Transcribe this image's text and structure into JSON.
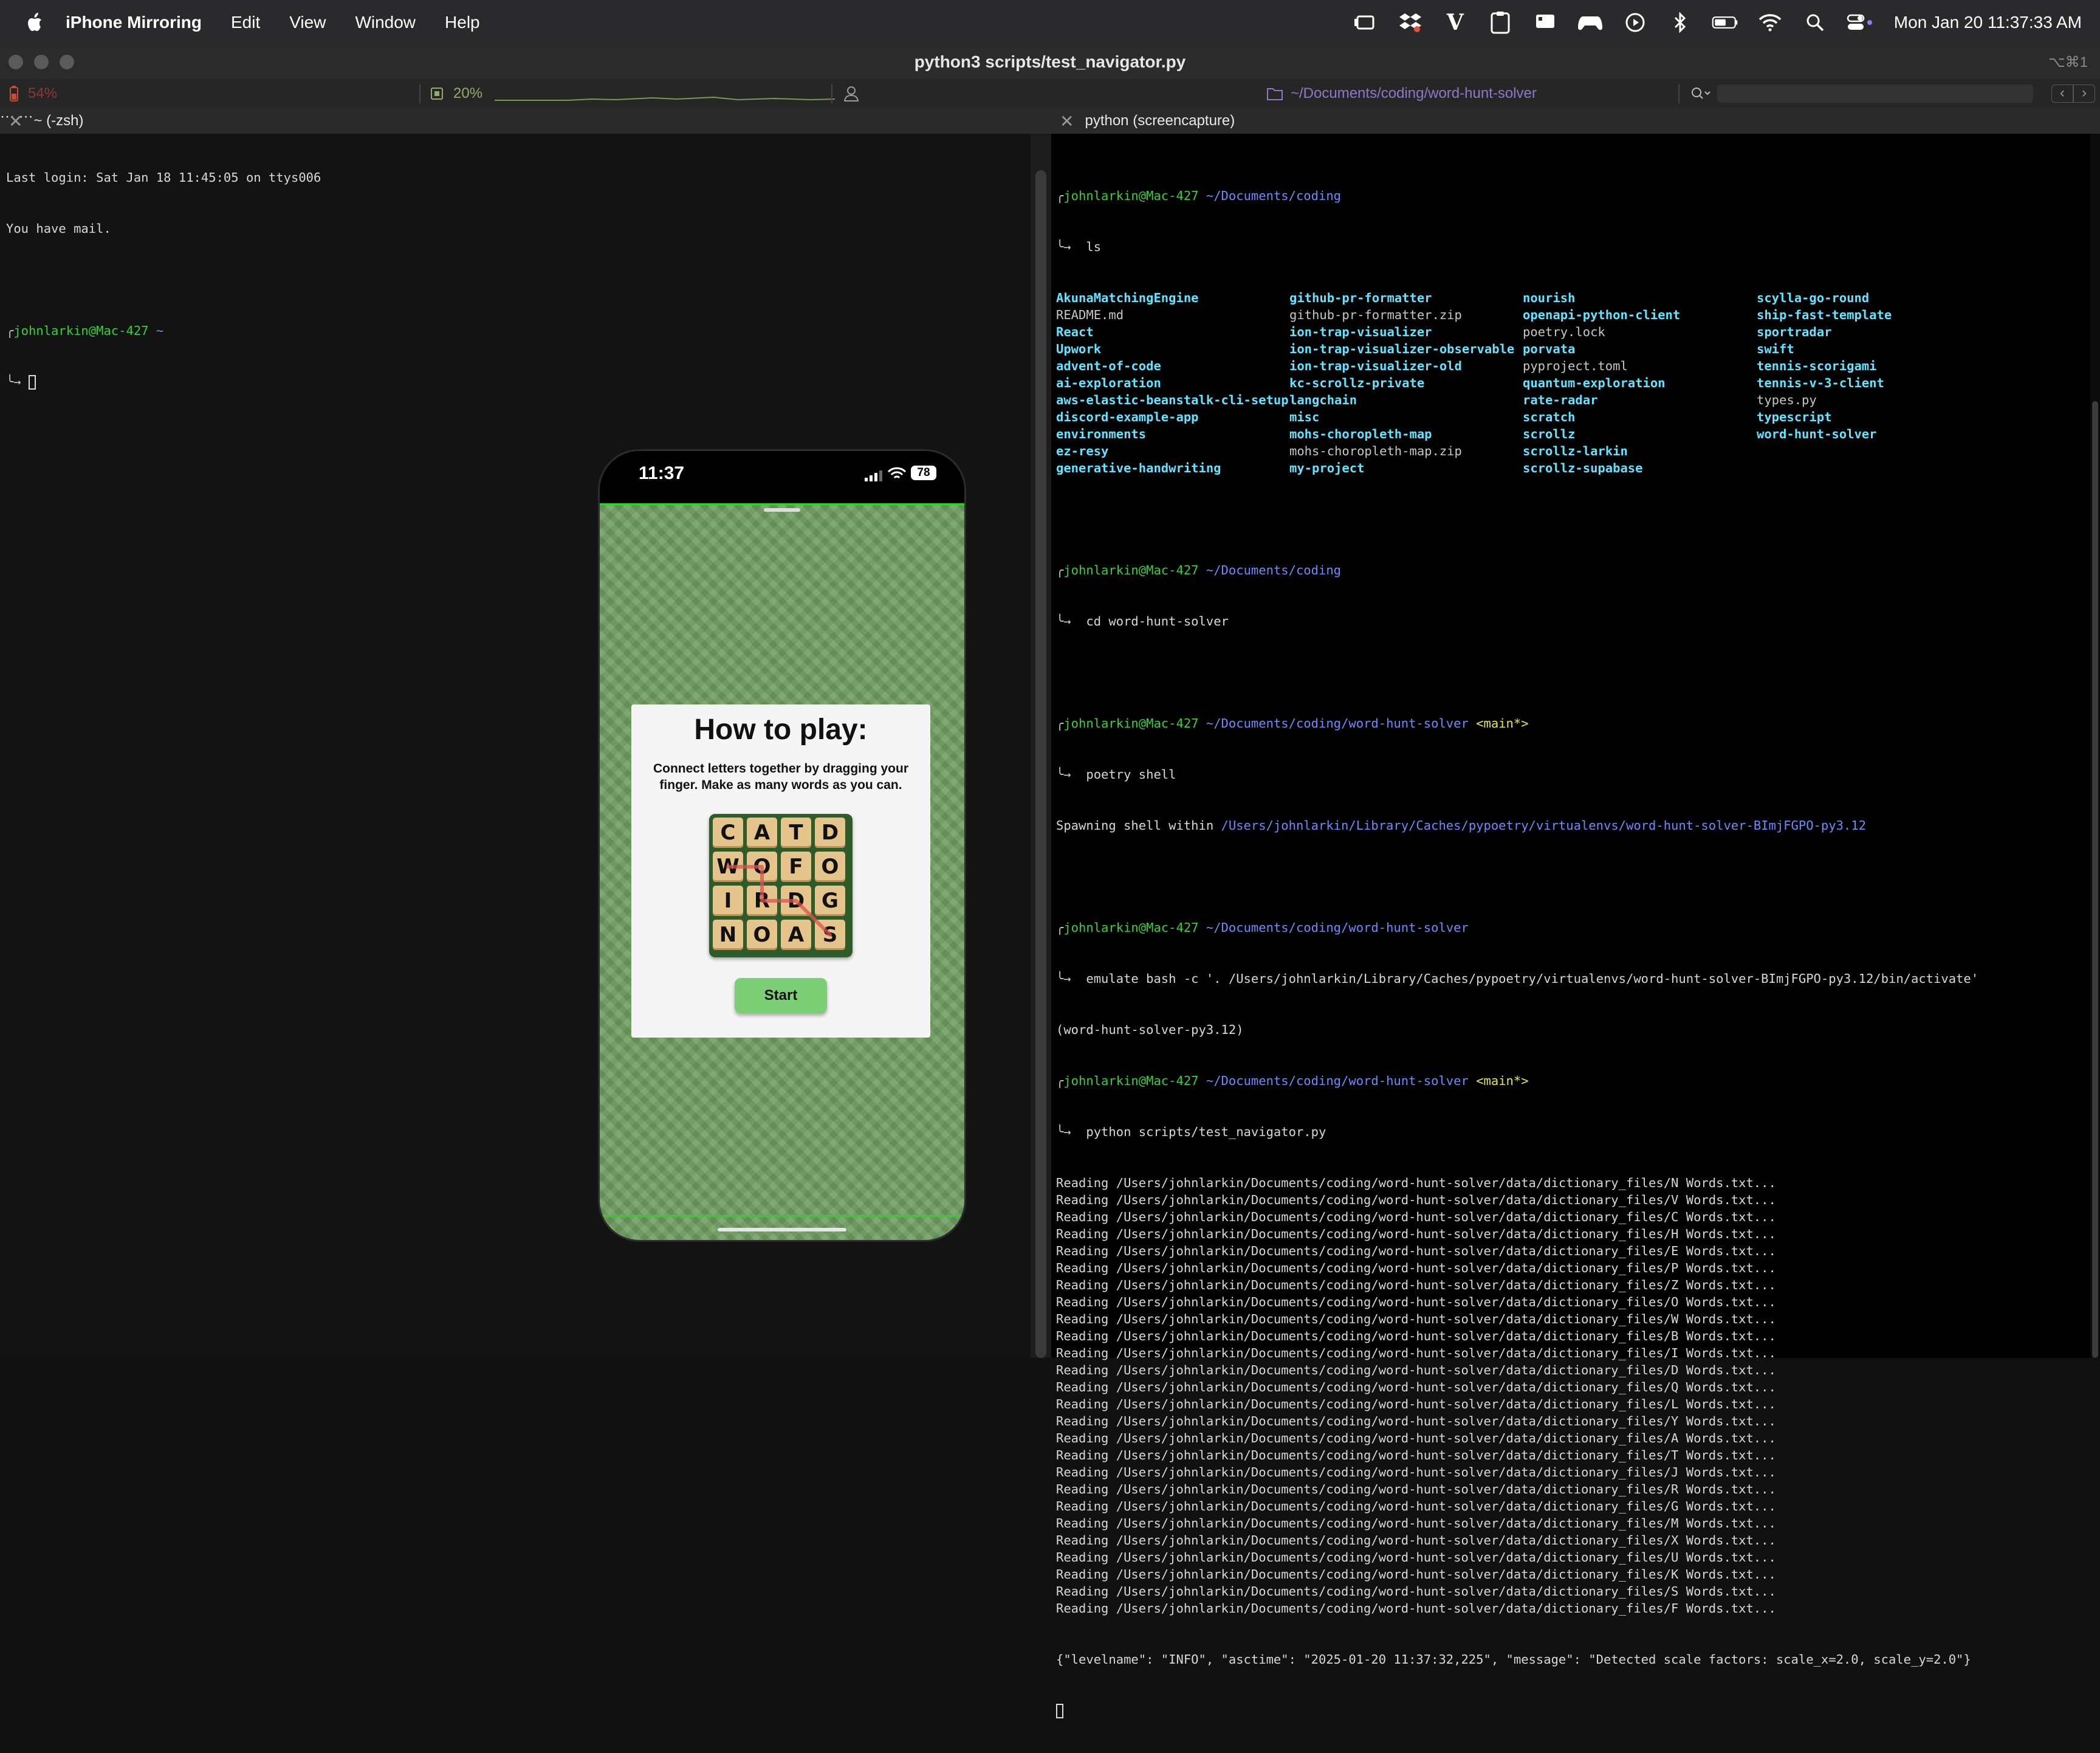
{
  "menubar": {
    "app_name": "iPhone Mirroring",
    "items": [
      "Edit",
      "View",
      "Window",
      "Help"
    ],
    "clock": "Mon Jan 20  11:37:33 AM",
    "icons": [
      "stage-manager-icon",
      "dropbox-icon",
      "vim-icon",
      "clipboard-icon",
      "display-icon",
      "game-controller-icon",
      "play-icon",
      "bluetooth-icon",
      "battery-icon",
      "wifi-icon",
      "spotlight-search-icon",
      "control-center-icon"
    ]
  },
  "window": {
    "title": "python3 scripts/test_navigator.py",
    "shortcut": "⌥⌘1"
  },
  "status_bar": {
    "battery": "54%",
    "cpu": "20%",
    "path": "~/Documents/coding/word-hunt-solver"
  },
  "tabs": {
    "left": "~ (-zsh)",
    "right": "python (screencapture)"
  },
  "left_terminal": {
    "lines": [
      "Last login: Sat Jan 18 11:45:05 on ttys006",
      "You have mail."
    ],
    "prompt_user": "johnlarkin@Mac-427",
    "prompt_path": "~"
  },
  "right_terminal": {
    "prompt_user": "johnlarkin@Mac-427",
    "path_coding": "~/Documents/coding",
    "path_solver": "~/Documents/coding/word-hunt-solver",
    "branch": "<main*>",
    "cmd_ls": "ls",
    "ls_columns": [
      [
        "AkunaMatchingEngine",
        "README.md",
        "React",
        "Upwork",
        "advent-of-code",
        "ai-exploration",
        "aws-elastic-beanstalk-cli-setup",
        "discord-example-app",
        "environments",
        "ez-resy",
        "generative-handwriting"
      ],
      [
        "github-pr-formatter",
        "github-pr-formatter.zip",
        "ion-trap-visualizer",
        "ion-trap-visualizer-observable",
        "ion-trap-visualizer-old",
        "kc-scrollz-private",
        "langchain",
        "misc",
        "mohs-choropleth-map",
        "mohs-choropleth-map.zip",
        "my-project"
      ],
      [
        "nourish",
        "openapi-python-client",
        "poetry.lock",
        "porvata",
        "pyproject.toml",
        "quantum-exploration",
        "rate-radar",
        "scratch",
        "scrollz",
        "scrollz-larkin",
        "scrollz-supabase"
      ],
      [
        "scylla-go-round",
        "ship-fast-template",
        "sportradar",
        "swift",
        "tennis-scorigami",
        "tennis-v-3-client",
        "types.py",
        "typescript",
        "word-hunt-solver"
      ]
    ],
    "cmd_cd": "cd word-hunt-solver",
    "cmd_poetry": "poetry shell",
    "spawning_label": "Spawning shell within ",
    "venv_path": "/Users/johnlarkin/Library/Caches/pypoetry/virtualenvs/word-hunt-solver-BImjFGPO-py3.12",
    "cmd_emulate": "emulate bash -c '. /Users/johnlarkin/Library/Caches/pypoetry/virtualenvs/word-hunt-solver-BImjFGPO-py3.12/bin/activate'",
    "venv_name": "(word-hunt-solver-py3.12)",
    "cmd_python": "python scripts/test_navigator.py",
    "reading_lines": [
      "Reading /Users/johnlarkin/Documents/coding/word-hunt-solver/data/dictionary_files/N Words.txt...",
      "Reading /Users/johnlarkin/Documents/coding/word-hunt-solver/data/dictionary_files/V Words.txt...",
      "Reading /Users/johnlarkin/Documents/coding/word-hunt-solver/data/dictionary_files/C Words.txt...",
      "Reading /Users/johnlarkin/Documents/coding/word-hunt-solver/data/dictionary_files/H Words.txt...",
      "Reading /Users/johnlarkin/Documents/coding/word-hunt-solver/data/dictionary_files/E Words.txt...",
      "Reading /Users/johnlarkin/Documents/coding/word-hunt-solver/data/dictionary_files/P Words.txt...",
      "Reading /Users/johnlarkin/Documents/coding/word-hunt-solver/data/dictionary_files/Z Words.txt...",
      "Reading /Users/johnlarkin/Documents/coding/word-hunt-solver/data/dictionary_files/O Words.txt...",
      "Reading /Users/johnlarkin/Documents/coding/word-hunt-solver/data/dictionary_files/W Words.txt...",
      "Reading /Users/johnlarkin/Documents/coding/word-hunt-solver/data/dictionary_files/B Words.txt...",
      "Reading /Users/johnlarkin/Documents/coding/word-hunt-solver/data/dictionary_files/I Words.txt...",
      "Reading /Users/johnlarkin/Documents/coding/word-hunt-solver/data/dictionary_files/D Words.txt...",
      "Reading /Users/johnlarkin/Documents/coding/word-hunt-solver/data/dictionary_files/Q Words.txt...",
      "Reading /Users/johnlarkin/Documents/coding/word-hunt-solver/data/dictionary_files/L Words.txt...",
      "Reading /Users/johnlarkin/Documents/coding/word-hunt-solver/data/dictionary_files/Y Words.txt...",
      "Reading /Users/johnlarkin/Documents/coding/word-hunt-solver/data/dictionary_files/A Words.txt...",
      "Reading /Users/johnlarkin/Documents/coding/word-hunt-solver/data/dictionary_files/T Words.txt...",
      "Reading /Users/johnlarkin/Documents/coding/word-hunt-solver/data/dictionary_files/J Words.txt...",
      "Reading /Users/johnlarkin/Documents/coding/word-hunt-solver/data/dictionary_files/R Words.txt...",
      "Reading /Users/johnlarkin/Documents/coding/word-hunt-solver/data/dictionary_files/G Words.txt...",
      "Reading /Users/johnlarkin/Documents/coding/word-hunt-solver/data/dictionary_files/M Words.txt...",
      "Reading /Users/johnlarkin/Documents/coding/word-hunt-solver/data/dictionary_files/X Words.txt...",
      "Reading /Users/johnlarkin/Documents/coding/word-hunt-solver/data/dictionary_files/U Words.txt...",
      "Reading /Users/johnlarkin/Documents/coding/word-hunt-solver/data/dictionary_files/K Words.txt...",
      "Reading /Users/johnlarkin/Documents/coding/word-hunt-solver/data/dictionary_files/S Words.txt...",
      "Reading /Users/johnlarkin/Documents/coding/word-hunt-solver/data/dictionary_files/F Words.txt..."
    ],
    "json_log": "{\"levelname\": \"INFO\", \"asctime\": \"2025-01-20 11:37:32,225\", \"message\": \"Detected scale factors: scale_x=2.0, scale_y=2.0\"}"
  },
  "phone": {
    "time": "11:37",
    "battery": "78",
    "card_title": "How to play:",
    "card_desc": "Connect letters together by dragging your finger. Make as many words as you can.",
    "board": [
      [
        "C",
        "A",
        "T",
        "D"
      ],
      [
        "W",
        "O",
        "F",
        "O"
      ],
      [
        "I",
        "R",
        "D",
        "G"
      ],
      [
        "N",
        "O",
        "A",
        "S"
      ]
    ],
    "start_label": "Start"
  },
  "colors": {
    "terminal_green": "#37d039",
    "terminal_blue": "#6d8cff",
    "terminal_yellow": "#e6e84a",
    "ls_dir_cyan": "#62e3ff",
    "phone_frame_green": "#27d626",
    "start_button": "#7ccf74"
  }
}
